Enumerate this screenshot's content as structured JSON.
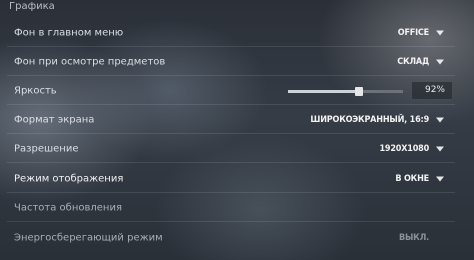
{
  "section_title": "Графика",
  "rows": [
    {
      "label": "Фон в главном меню",
      "value": "OFFICE"
    },
    {
      "label": "Фон при осмотре предметов",
      "value": "СКЛАД"
    },
    {
      "label": "Яркость",
      "slider_percent": 92,
      "value": "92%"
    },
    {
      "label": "Формат экрана",
      "value": "ШИРОКОЭКРАННЫЙ, 16:9"
    },
    {
      "label": "Разрешение",
      "value": "1920X1080"
    },
    {
      "label": "Режим отображения",
      "value": "В ОКНЕ"
    },
    {
      "label": "Частота обновления",
      "value": ""
    },
    {
      "label": "Энергосберегающий режим",
      "value": "ВЫКЛ."
    }
  ]
}
